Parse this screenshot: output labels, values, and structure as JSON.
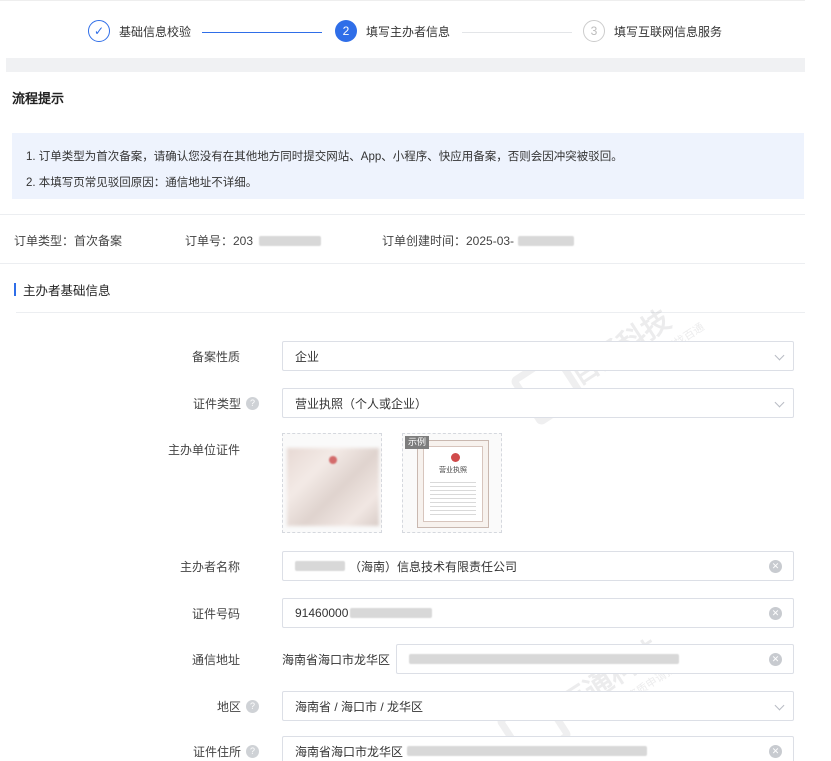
{
  "steps": [
    {
      "number": "✓",
      "label": "基础信息校验"
    },
    {
      "number": "2",
      "label": "填写主办者信息"
    },
    {
      "number": "3",
      "label": "填写互联网信息服务"
    }
  ],
  "process_tip": {
    "title": "流程提示",
    "lines": [
      "1. 订单类型为首次备案，请确认您没有在其他地方同时提交网站、App、小程序、快应用备案，否则会因冲突被驳回。",
      "2. 本填写页常见驳回原因：通信地址不详细。"
    ]
  },
  "order": {
    "type": "订单类型：首次备案",
    "number": "订单号：203",
    "created": "订单创建时间：2025-03-"
  },
  "section": {
    "title": "主办者基础信息"
  },
  "form": {
    "filing_nature": {
      "label": "备案性质",
      "value": "企业"
    },
    "cert_type": {
      "label": "证件类型",
      "value": "营业执照（个人或企业）"
    },
    "unit_cert": {
      "label": "主办单位证件",
      "sample_tag": "示例",
      "sample_title": "营业执照"
    },
    "sponsor_name": {
      "label": "主办者名称",
      "value": "（海南）信息技术有限责任公司"
    },
    "cert_number": {
      "label": "证件号码",
      "value": "91460000"
    },
    "address": {
      "label": "通信地址",
      "prefix": "海南省海口市龙华区"
    },
    "region": {
      "label": "地区",
      "value": "海南省 / 海口市 / 龙华区"
    },
    "cert_residence": {
      "label": "证件住所",
      "value": "海南省海口市龙华区"
    }
  },
  "watermark": {
    "text": "百通科技",
    "sub": "资质申请找百通"
  },
  "colors": {
    "accent": "#2f6ee8",
    "notice_bg": "#eef3fd"
  }
}
